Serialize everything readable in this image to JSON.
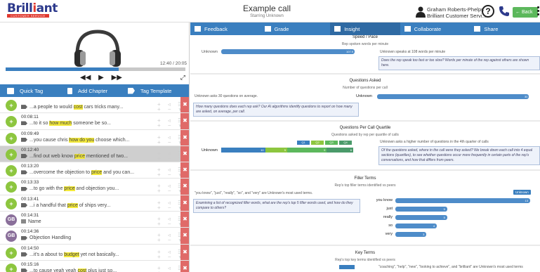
{
  "brand": {
    "name_pre": "Brill",
    "name_i": "i",
    "name_post": "ant",
    "tagline": "CUSTOMER SERVICE"
  },
  "call": {
    "title": "Example call",
    "subtitle": "Starring Unknown"
  },
  "user": {
    "name": "Graham Roberts-Phelps",
    "company": "Brilliant Customer Servi..."
  },
  "header": {
    "help_glyph": "?",
    "back_label": "← Back"
  },
  "player": {
    "time": "12:40 / 20:05",
    "progress": 0.63,
    "prev": "◀◀",
    "play": "▶",
    "next": "▶▶",
    "expand": "⤢"
  },
  "toolbar": {
    "quick_tag": "Quick Tag",
    "add_chapter": "Add Chapter",
    "tag_template": "Tag Template"
  },
  "rows": [
    {
      "badge": "+",
      "time": "",
      "pre": "...a people to would ",
      "hl": "cost",
      "post": " cars tricks many...",
      "type": "tag",
      "selected": false
    },
    {
      "badge": "+",
      "time": "00:08:11",
      "pre": "...to it so ",
      "hl": "how much",
      "post": " someone be so...",
      "type": "tag",
      "selected": false
    },
    {
      "badge": "+",
      "time": "00:09:49",
      "pre": "...you cause chris ",
      "hl": "how do you",
      "post": " choose which...",
      "type": "tag",
      "selected": false,
      "star": true
    },
    {
      "badge": "+",
      "time": "00:12:40",
      "pre": "...find out web know ",
      "hl": "price",
      "post": " mentioned of two...",
      "type": "tag",
      "selected": true
    },
    {
      "badge": "+",
      "time": "00:13:20",
      "pre": "...overcome the objection to ",
      "hl": "price",
      "post": " and you can...",
      "type": "tag",
      "selected": false
    },
    {
      "badge": "+",
      "time": "00:13:33",
      "pre": "...to go with the ",
      "hl": "price",
      "post": " and objection you...",
      "type": "tag",
      "selected": false
    },
    {
      "badge": "+",
      "time": "00:13:41",
      "pre": "...i a handful that ",
      "hl": "price",
      "post": " of ships very...",
      "type": "tag",
      "selected": false
    },
    {
      "badge": "GB",
      "time": "00:14:31",
      "pre": "Name",
      "hl": "",
      "post": "",
      "type": "note",
      "selected": false
    },
    {
      "badge": "GB",
      "time": "00:14:36",
      "pre": "Objection Handling",
      "hl": "",
      "post": "",
      "type": "tag",
      "selected": false
    },
    {
      "badge": "+",
      "time": "00:14:50",
      "pre": "...it's a about to ",
      "hl": "budget",
      "post": " yet not basically...",
      "type": "tag",
      "selected": false
    },
    {
      "badge": "+",
      "time": "00:15:16",
      "pre": "...to cause yeah yeah ",
      "hl": "cost",
      "post": " plus just so...",
      "type": "tag",
      "selected": false
    }
  ],
  "row_actions": {
    "top": "+ ◃ ☰",
    "bottom": "+ − ★",
    "delete": "✖"
  },
  "tabs": [
    {
      "label": "Feedback",
      "active": false
    },
    {
      "label": "Grade",
      "active": false
    },
    {
      "label": "Insight",
      "active": true
    },
    {
      "label": "Collaborate",
      "active": false
    },
    {
      "label": "Share",
      "active": false
    }
  ],
  "insight": {
    "speed": {
      "title": "Speed / Pace",
      "subtitle": "Rep spoken words per minute",
      "speaker": "Unknown",
      "value": "107.9",
      "desc": "Unknown speaks at 108 words per minute",
      "note": "Does the rep speak too fast or too slow? Words per minute of the rep against others are shown here."
    },
    "questions": {
      "title": "Questions Asked",
      "subtitle": "Number of questions per call",
      "desc": "Unknown asks 30 questions on average.",
      "speaker": "Unknown",
      "value": "30",
      "note": "How many questions does each rep ask? Our AI algorithms identify questions to report on how many are asked, on average, per call."
    },
    "quartile": {
      "title": "Questions Per Call Quartile",
      "subtitle": "Questions asked by rep per quartile of calls",
      "desc": "Unknown asks a higher number of questions in the 4th quarter of calls",
      "speaker": "Unknown",
      "legend": [
        "Q1",
        "Q2",
        "Q3",
        "Q4"
      ],
      "values": [
        10,
        5,
        9,
        6
      ],
      "note": "Of the questions asked, where in the call were they asked? We break down each call into 4 equal sections (quartiles), to see whether questions occur more frequently in certain parts of the rep's conversations, and how that differs from peers."
    },
    "filler": {
      "title": "Filler Terms",
      "subtitle": "Rep's top filler terms identified vs peers",
      "desc": "\"you know\", \"just\", \"really\", \"so\", and \"very\" are Unknown's most used terms.",
      "note": "Examining a list of recognized filler words, what are the rep's top 5 filler words used, and how do they compare to others?",
      "legend": "Unknown",
      "terms": [
        {
          "term": "you know",
          "value": 13
        },
        {
          "term": "just",
          "value": 5
        },
        {
          "term": "really",
          "value": 5
        },
        {
          "term": "so",
          "value": 4
        },
        {
          "term": "very",
          "value": 3
        }
      ]
    },
    "key_terms": {
      "title": "Key Terms",
      "subtitle": "Rep's top key terms identified vs peers",
      "desc": "\"coaching\", \"help\", \"new\", \"looking to achieve\", and \"brilliant\" are Unknown's most used terms"
    }
  },
  "colors": {
    "blue": "#3a7fbf",
    "green": "#8dc63f",
    "red": "#e06a68",
    "highlight": "#f4ea3a"
  }
}
